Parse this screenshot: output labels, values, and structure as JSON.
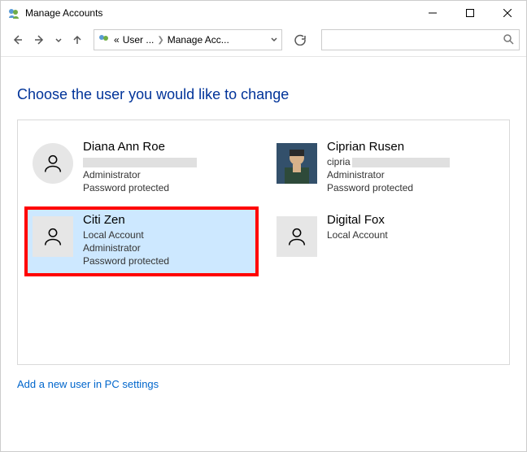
{
  "window": {
    "title": "Manage Accounts"
  },
  "breadcrumb": {
    "prefix": "«",
    "part1": "User ...",
    "part2": "Manage Acc..."
  },
  "page": {
    "heading": "Choose the user you would like to change",
    "footer_link": "Add a new user in PC settings"
  },
  "accounts": [
    {
      "name": "Diana Ann Roe",
      "line2_redacted": true,
      "line3": "Administrator",
      "line4": "Password protected",
      "avatar_kind": "circle",
      "selected": false
    },
    {
      "name": "Ciprian Rusen",
      "email_prefix": "cipria",
      "email_rest_redacted": true,
      "line3": "Administrator",
      "line4": "Password protected",
      "avatar_kind": "photo",
      "selected": false
    },
    {
      "name": "Citi Zen",
      "line2": "Local Account",
      "line3": "Administrator",
      "line4": "Password protected",
      "avatar_kind": "square",
      "selected": true
    },
    {
      "name": "Digital Fox",
      "line2": "Local Account",
      "avatar_kind": "square",
      "selected": false
    }
  ]
}
